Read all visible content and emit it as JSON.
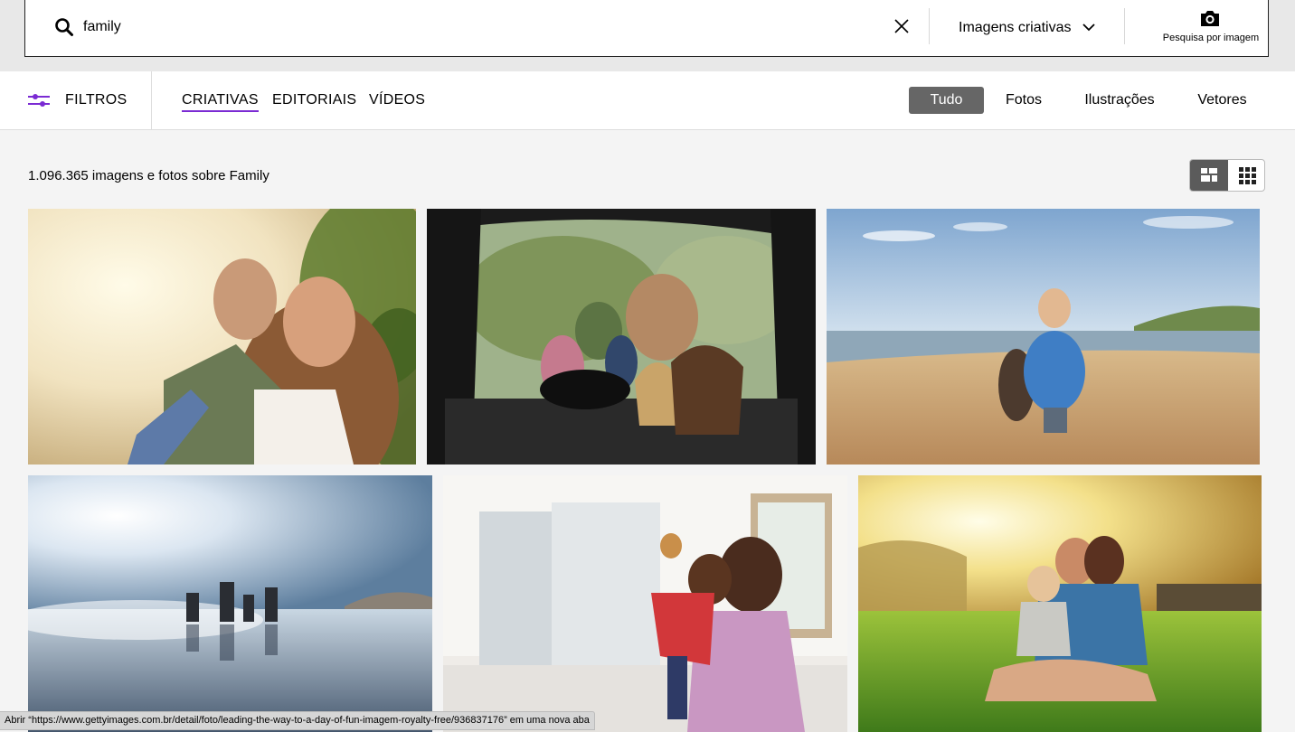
{
  "search": {
    "query": "family",
    "placeholder": "",
    "type_label": "Imagens criativas",
    "image_search_label": "Pesquisa por imagem"
  },
  "filters": {
    "label": "FILTROS",
    "tabs": [
      {
        "label": "CRIATIVAS",
        "active": true
      },
      {
        "label": "EDITORIAIS",
        "active": false
      },
      {
        "label": "VÍDEOS",
        "active": false
      }
    ],
    "media_types": [
      {
        "label": "Tudo",
        "selected": true
      },
      {
        "label": "Fotos",
        "selected": false
      },
      {
        "label": "Ilustrações",
        "selected": false
      },
      {
        "label": "Vetores",
        "selected": false
      }
    ]
  },
  "results": {
    "count_text": "1.096.365 imagens e fotos sobre Family"
  },
  "colors": {
    "accent": "#7b2bd3",
    "selected_chip": "#666666"
  },
  "status_bar": {
    "text": "Abrir “https://www.gettyimages.com.br/detail/foto/leading-the-way-to-a-day-of-fun-imagem-royalty-free/936837176” em uma nova aba"
  }
}
